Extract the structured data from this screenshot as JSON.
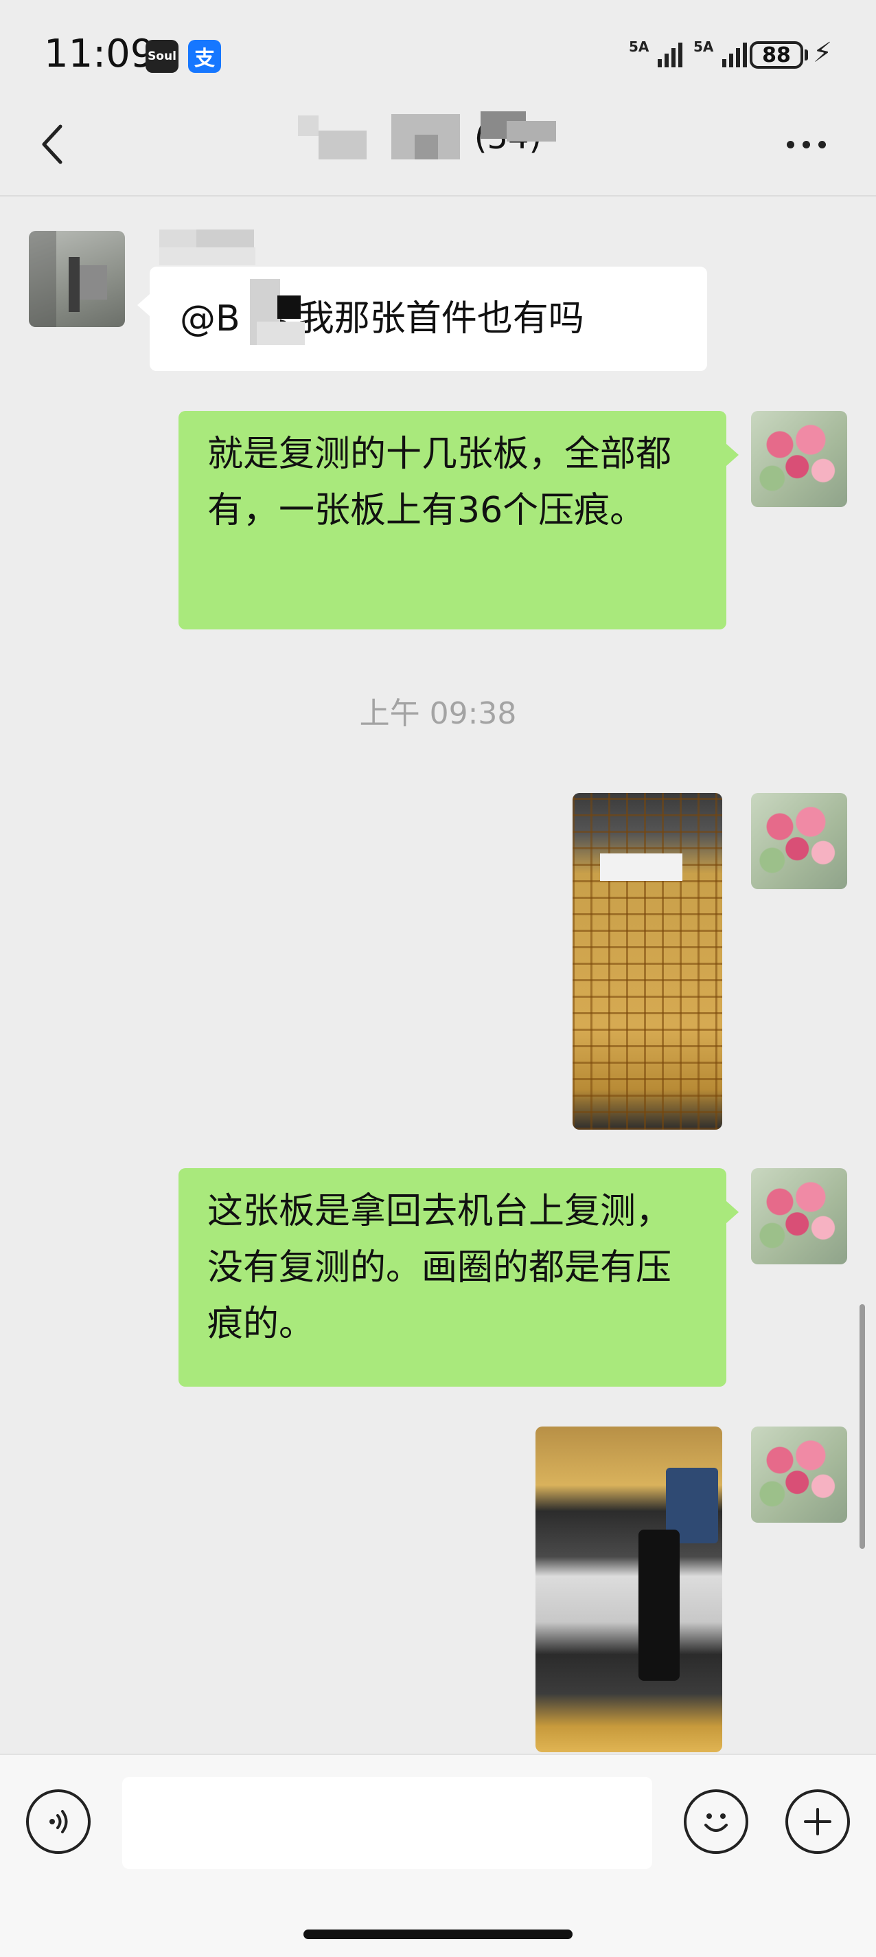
{
  "status_bar": {
    "time": "11:09",
    "app_badges": [
      "Soul",
      "支"
    ],
    "signal_labels": [
      "5A",
      "5A"
    ],
    "battery": "88"
  },
  "header": {
    "title": "(54)",
    "icons": [
      "back-arrow-icon",
      "more-icon"
    ]
  },
  "messages": [
    {
      "sender": "other",
      "text": "@B 琴 我那张首件也有吗"
    },
    {
      "sender": "self",
      "text": "就是复测的十几张板，全部都有，一张板上有36个压痕。"
    },
    {
      "type": "timestamp",
      "text": "上午 09:38"
    },
    {
      "sender": "self",
      "type": "image",
      "icon": "photo-pcb-board"
    },
    {
      "sender": "self",
      "text": "这张板是拿回去机台上复测，没有复测的。画圈的都是有压痕的。"
    },
    {
      "sender": "self",
      "type": "image",
      "icon": "photo-microscope-camera"
    }
  ],
  "input_bar": {
    "placeholder": "",
    "icons": [
      "voice-icon",
      "emoji-icon",
      "add-icon"
    ]
  },
  "colors": {
    "background": "#ededed",
    "self_bubble": "#a9e97c",
    "other_bubble": "#ffffff",
    "timestamp": "#a3a3a3"
  }
}
